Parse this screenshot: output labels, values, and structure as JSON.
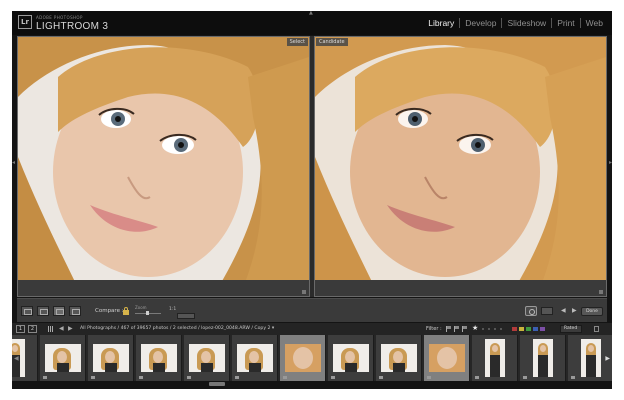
{
  "app": {
    "brand_small": "ADOBE PHOTOSHOP",
    "brand_main": "LIGHTROOM 3",
    "logo_mark": "Lr",
    "modules": [
      {
        "label": "Library",
        "active": true
      },
      {
        "label": "Develop",
        "active": false
      },
      {
        "label": "Slideshow",
        "active": false
      },
      {
        "label": "Print",
        "active": false
      },
      {
        "label": "Web",
        "active": false
      }
    ]
  },
  "compare": {
    "select_tag": "Select",
    "candidate_tag": "Candidate"
  },
  "toolbar": {
    "compare_label": "Compare :",
    "zoom_label": "Zoom",
    "zoom_value": "1:1",
    "done_label": "Done"
  },
  "filmstrip": {
    "monitor_1": "1",
    "monitor_2": "2",
    "path": "All Photographs / 467 of 39657 photos / 2 selected / lopez-002_0048.ARW / Copy 2 ▾",
    "filter_label": "Filter :",
    "rated_label": "Rated",
    "thumbnails": [
      {
        "kind": "tall",
        "selected": false
      },
      {
        "kind": "pose",
        "selected": false
      },
      {
        "kind": "pose",
        "selected": false
      },
      {
        "kind": "pose",
        "selected": false
      },
      {
        "kind": "pose",
        "selected": false
      },
      {
        "kind": "pose",
        "selected": false
      },
      {
        "kind": "closeup",
        "selected": true
      },
      {
        "kind": "pose",
        "selected": false
      },
      {
        "kind": "pose",
        "selected": false
      },
      {
        "kind": "closeup",
        "selected": true
      },
      {
        "kind": "tall",
        "selected": false
      },
      {
        "kind": "tall",
        "selected": false
      },
      {
        "kind": "tall",
        "selected": false
      }
    ]
  },
  "colors": {
    "accent_lock": "#d6b34a",
    "label_red": "#b23b3b",
    "label_yellow": "#c9b43c",
    "label_green": "#3f9a3f",
    "label_blue": "#3b5fb3",
    "label_purple": "#7c4fa6"
  }
}
